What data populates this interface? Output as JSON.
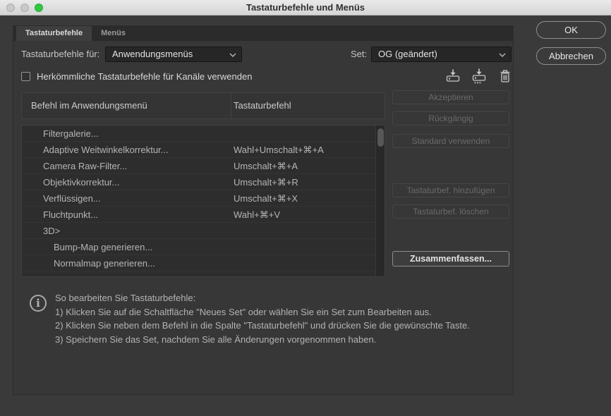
{
  "window": {
    "title": "Tastaturbefehle und Menüs"
  },
  "tabs": [
    {
      "label": "Tastaturbefehle"
    },
    {
      "label": "Menüs"
    }
  ],
  "controls": {
    "shortcuts_for_label": "Tastaturbefehle für:",
    "shortcuts_for_value": "Anwendungsmenüs",
    "set_label": "Set:",
    "set_value": "OG (geändert)",
    "legacy_checkbox_label": "Herkömmliche Tastaturbefehle für Kanäle verwenden",
    "legacy_checkbox_checked": false
  },
  "icons": {
    "traffic_lights": [
      "window-close",
      "window-minimize",
      "window-zoom"
    ],
    "set_icons": [
      "save-set-icon",
      "save-set-as-icon",
      "trash-icon"
    ],
    "dropdown": "chevron-down-icon",
    "info": "info-circle-icon"
  },
  "table": {
    "columns": [
      "Befehl im Anwendungsmenü",
      "Tastaturbefehl"
    ],
    "rows": [
      {
        "command": "Filtergalerie...",
        "shortcut": ""
      },
      {
        "command": "Adaptive Weitwinkelkorrektur...",
        "shortcut": "Wahl+Umschalt+⌘+A"
      },
      {
        "command": "Camera Raw-Filter...",
        "shortcut": "Umschalt+⌘+A"
      },
      {
        "command": "Objektivkorrektur...",
        "shortcut": "Umschalt+⌘+R"
      },
      {
        "command": "Verflüssigen...",
        "shortcut": "Umschalt+⌘+X"
      },
      {
        "command": "Fluchtpunkt...",
        "shortcut": "Wahl+⌘+V"
      },
      {
        "command": "3D>",
        "shortcut": ""
      },
      {
        "command": "Bump-Map generieren...",
        "shortcut": "",
        "indent": true
      },
      {
        "command": "Normalmap generieren...",
        "shortcut": "",
        "indent": true
      }
    ]
  },
  "side_buttons": [
    {
      "label": "Akzeptieren",
      "enabled": false
    },
    {
      "label": "Rückgängig",
      "enabled": false
    },
    {
      "label": "Standard verwenden",
      "enabled": false
    },
    {
      "label": "Tastaturbef. hinzufügen",
      "enabled": false
    },
    {
      "label": "Tastaturbef. löschen",
      "enabled": false
    },
    {
      "label": "Zusammenfassen...",
      "enabled": true
    }
  ],
  "info": {
    "heading": "So bearbeiten Sie Tastaturbefehle:",
    "steps": [
      "1) Klicken Sie auf die Schaltfläche \"Neues Set\" oder wählen Sie ein Set zum Bearbeiten aus.",
      "2) Klicken Sie neben dem Befehl in die Spalte \"Tastaturbefehl\" und drücken Sie die gewünschte Taste.",
      "3) Speichern Sie das Set, nachdem Sie alle Änderungen vorgenommen haben."
    ]
  },
  "dialog_buttons": {
    "ok": "OK",
    "cancel": "Abbrechen"
  },
  "colors": {
    "traffic_light_green": "#2fc841",
    "window_bg": "#3a3a3a",
    "titlebar_bg": "#e6e6e6",
    "panel_bg": "#373737",
    "list_bg": "#2d2d2d"
  }
}
